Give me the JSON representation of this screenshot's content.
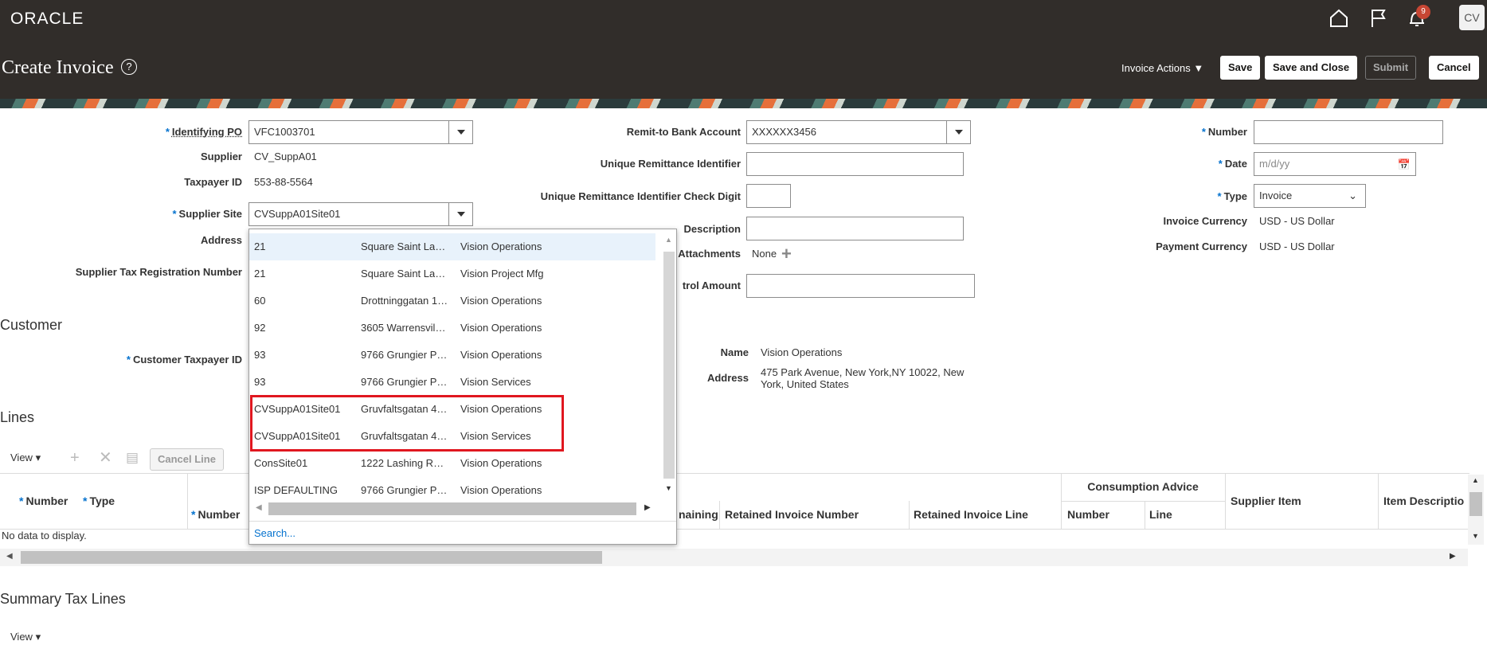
{
  "app": {
    "logo": "ORACLE",
    "notification_count": "9",
    "user_initials": "CV"
  },
  "header": {
    "title": "Create Invoice",
    "help": "?",
    "invoice_actions": "Invoice Actions",
    "save": "Save",
    "save_and_close": "Save and Close",
    "submit": "Submit",
    "cancel": "Cancel"
  },
  "form": {
    "identifying_po": {
      "label": "Identifying PO",
      "value": "VFC1003701"
    },
    "supplier": {
      "label": "Supplier",
      "value": "CV_SuppA01"
    },
    "taxpayer_id": {
      "label": "Taxpayer ID",
      "value": "553-88-5564"
    },
    "supplier_site": {
      "label": "Supplier Site",
      "value": "CVSuppA01Site01"
    },
    "address": {
      "label": "Address"
    },
    "supplier_tax_reg": {
      "label": "Supplier Tax Registration Number"
    },
    "remit_bank": {
      "label": "Remit-to Bank Account",
      "value": "XXXXXX3456"
    },
    "unique_remit": {
      "label": "Unique Remittance Identifier"
    },
    "unique_remit_check": {
      "label": "Unique Remittance Identifier Check Digit"
    },
    "description": {
      "label": "Description"
    },
    "attachments": {
      "label": "Attachments",
      "value": "None"
    },
    "control_amount": {
      "label": "trol Amount"
    },
    "number": {
      "label": "Number"
    },
    "date": {
      "label": "Date",
      "placeholder": "m/d/yy"
    },
    "type": {
      "label": "Type",
      "value": "Invoice"
    },
    "invoice_currency": {
      "label": "Invoice Currency",
      "value": "USD - US Dollar"
    },
    "payment_currency": {
      "label": "Payment Currency",
      "value": "USD - US Dollar"
    }
  },
  "customer": {
    "section_title": "Customer",
    "taxpayer_label": "Customer Taxpayer ID",
    "name_label": "Name",
    "name_value": "Vision Operations",
    "address_label": "Address",
    "address_line1": "475 Park Avenue, New York,NY 10022, New",
    "address_line2": "York, United States"
  },
  "site_dropdown": {
    "rows": [
      {
        "site": "21",
        "address": "Square Saint La…",
        "bu": "Vision Operations"
      },
      {
        "site": "21",
        "address": "Square Saint La…",
        "bu": "Vision Project Mfg"
      },
      {
        "site": "60",
        "address": "Drottninggatan 1…",
        "bu": "Vision Operations"
      },
      {
        "site": "92",
        "address": "3605 Warrensvil…",
        "bu": "Vision Operations"
      },
      {
        "site": "93",
        "address": "9766 Grungier P…",
        "bu": "Vision Operations"
      },
      {
        "site": "93",
        "address": "9766 Grungier P…",
        "bu": "Vision Services"
      },
      {
        "site": "CVSuppA01Site01",
        "address": "Gruvfaltsgatan 4…",
        "bu": "Vision Operations"
      },
      {
        "site": "CVSuppA01Site01",
        "address": "Gruvfaltsgatan 4…",
        "bu": "Vision Services"
      },
      {
        "site": "ConsSite01",
        "address": "1222 Lashing R…",
        "bu": "Vision Operations"
      },
      {
        "site": "ISP DEFAULTING",
        "address": "9766 Grungier P…",
        "bu": "Vision Operations"
      }
    ],
    "search": "Search..."
  },
  "lines": {
    "section_title": "Lines",
    "view": "View",
    "cancel_line": "Cancel Line",
    "headers": {
      "number": "Number",
      "type": "Type",
      "sub_number": "Number",
      "remaining": "naining",
      "retained_invoice_number": "Retained Invoice Number",
      "retained_invoice_line": "Retained Invoice Line",
      "consumption_advice": "Consumption Advice",
      "ca_number": "Number",
      "ca_line": "Line",
      "supplier_item": "Supplier Item",
      "item_description": "Item Descriptio"
    },
    "empty": "No data to display."
  },
  "summary_tax": {
    "section_title": "Summary Tax Lines",
    "view": "View"
  }
}
